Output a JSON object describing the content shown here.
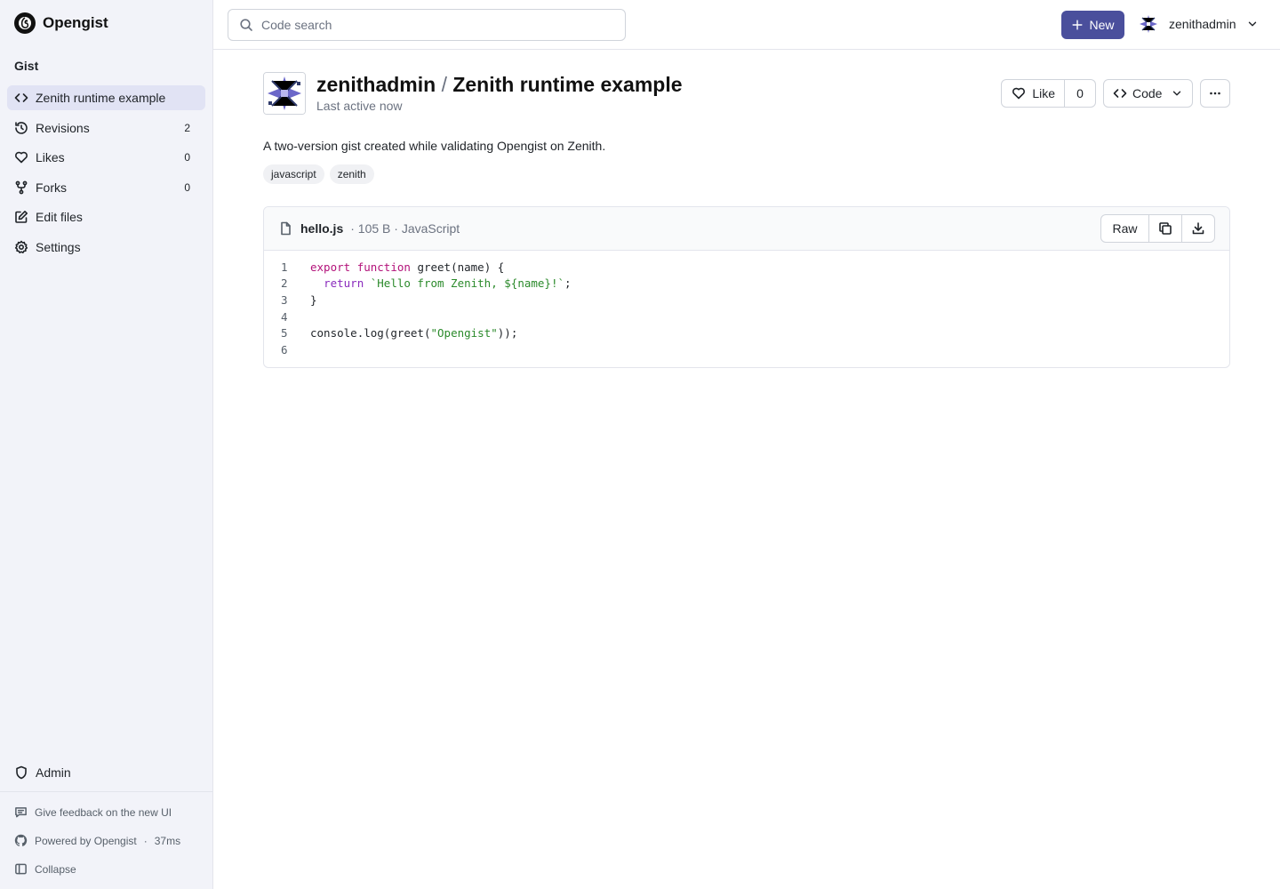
{
  "brand": {
    "name": "Opengist"
  },
  "search": {
    "placeholder": "Code search"
  },
  "topbar": {
    "new_label": "New",
    "username": "zenithadmin"
  },
  "sidebar": {
    "heading": "Gist",
    "items": [
      {
        "label": "Zenith runtime example",
        "icon": "code-icon",
        "count": null,
        "active": true
      },
      {
        "label": "Revisions",
        "icon": "history-icon",
        "count": "2"
      },
      {
        "label": "Likes",
        "icon": "heart-icon",
        "count": "0"
      },
      {
        "label": "Forks",
        "icon": "fork-icon",
        "count": "0"
      },
      {
        "label": "Edit files",
        "icon": "edit-icon",
        "count": null
      },
      {
        "label": "Settings",
        "icon": "gear-icon",
        "count": null
      }
    ],
    "admin_label": "Admin",
    "footer": {
      "feedback": "Give feedback on the new UI",
      "powered": "Powered by Opengist",
      "timing": "37ms",
      "collapse": "Collapse"
    }
  },
  "gist": {
    "owner": "zenithadmin",
    "separator": "/",
    "title": "Zenith runtime example",
    "subtitle": "Last active now",
    "like_label": "Like",
    "like_count": "0",
    "code_label": "Code",
    "description": "A two-version gist created while validating Opengist on Zenith.",
    "tags": [
      "javascript",
      "zenith"
    ]
  },
  "file": {
    "name": "hello.js",
    "meta": "· 105 B · JavaScript",
    "raw_label": "Raw",
    "line_numbers": [
      "1",
      "2",
      "3",
      "4",
      "5",
      "6"
    ],
    "lines": [
      "export function greet(name) {",
      "  return `Hello from Zenith, ${name}!`;",
      "}",
      "",
      "console.log(greet(\"Opengist\"));",
      ""
    ]
  },
  "colors": {
    "accent": "#4a4f9c",
    "sidebar_bg": "#f2f3f9",
    "active_item": "#e1e3f4",
    "keyword": "#b3127a",
    "string": "#2b8a2b"
  }
}
